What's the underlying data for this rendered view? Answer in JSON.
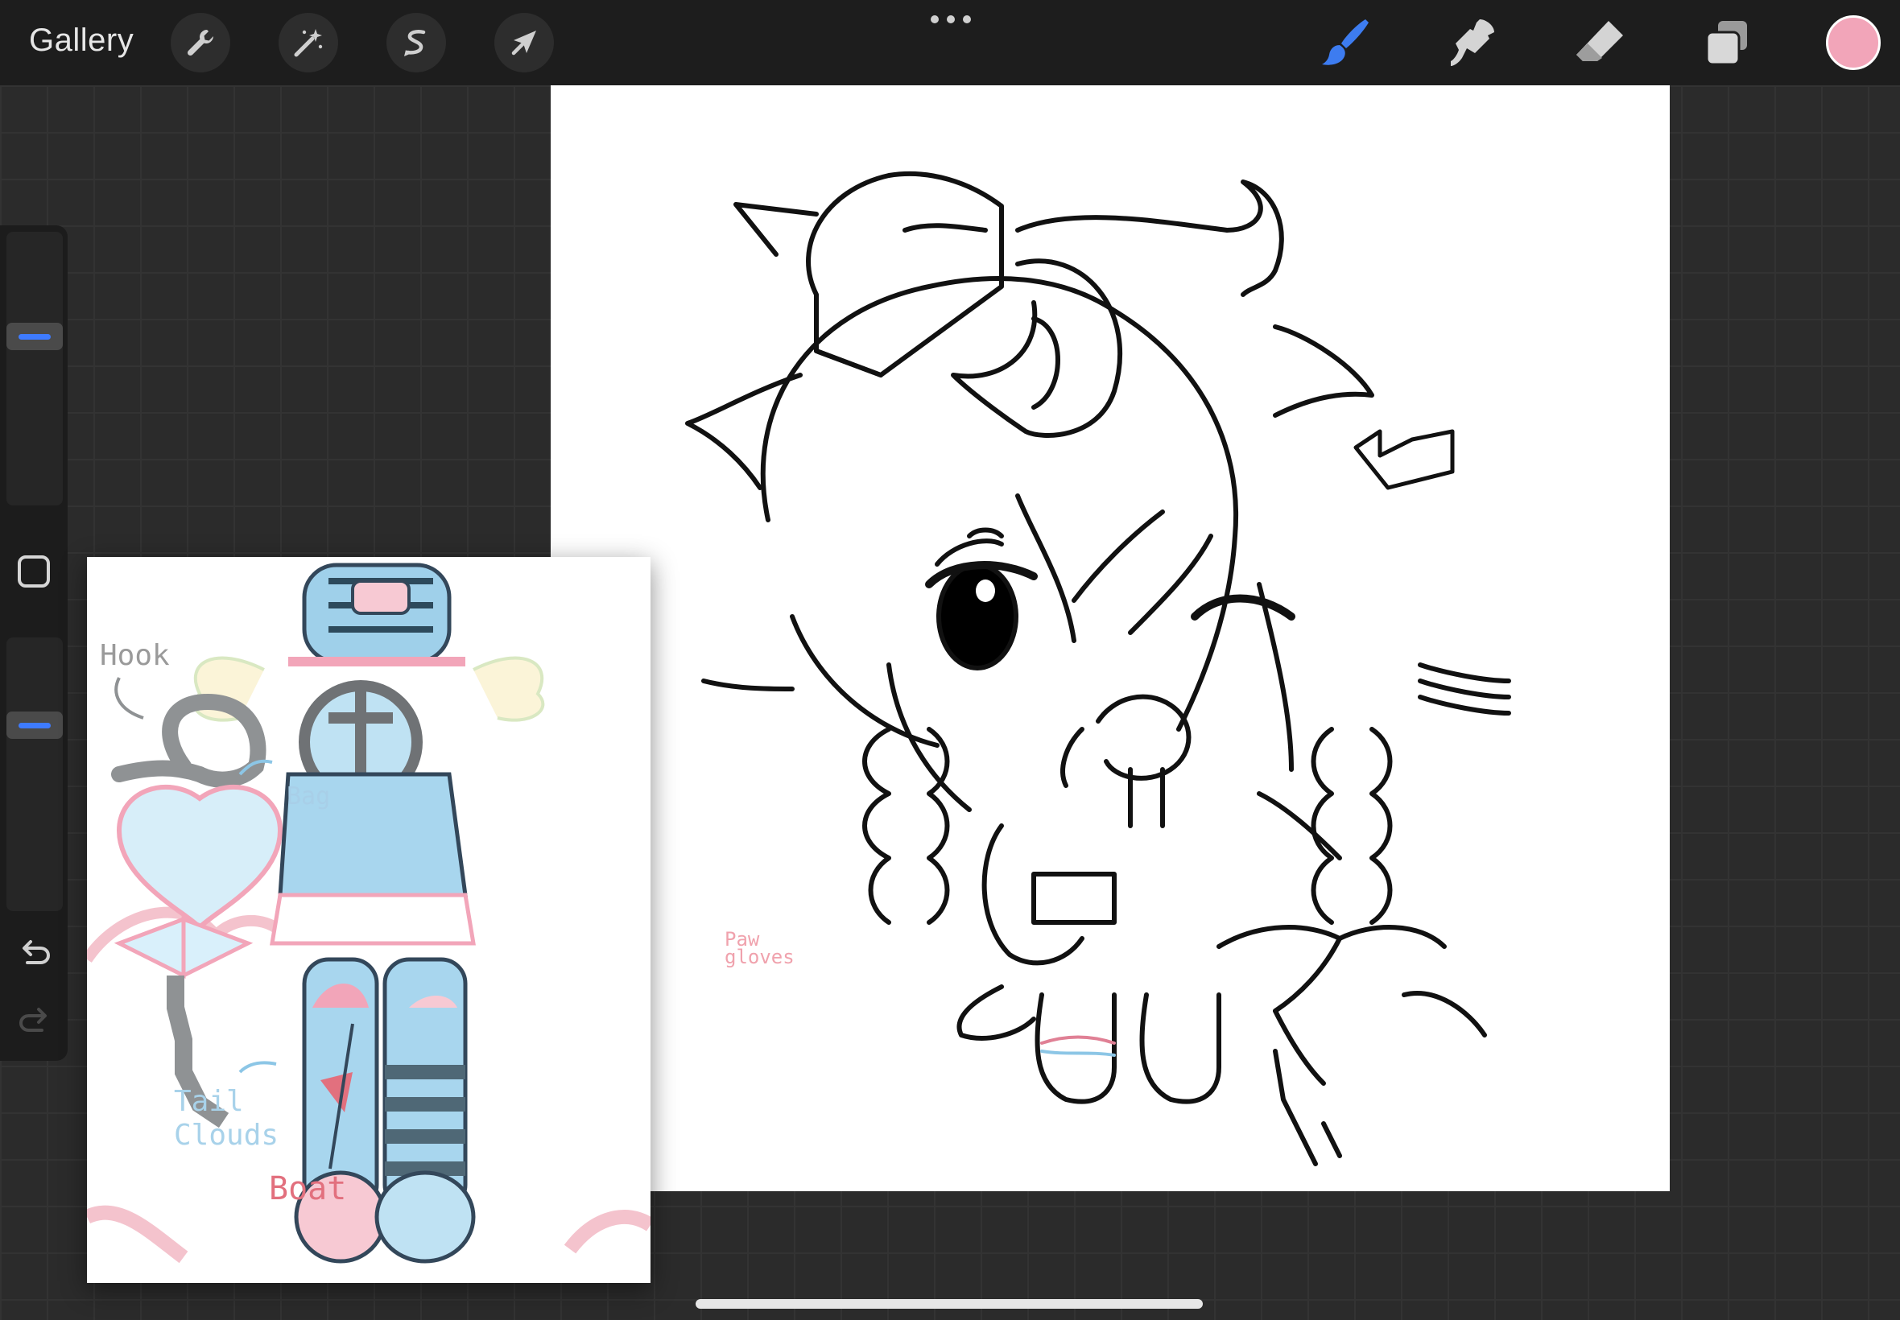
{
  "toolbar": {
    "gallery_label": "Gallery",
    "left_tools": [
      "wrench-icon",
      "magic-wand-icon",
      "selection-icon",
      "transform-arrow-icon"
    ],
    "right_tools": [
      "brush-icon",
      "smudge-icon",
      "eraser-icon",
      "layers-icon"
    ],
    "active_tool": "brush",
    "active_tool_color": "#3d7cf0",
    "current_color": "#f2a5b9"
  },
  "sidebar": {
    "brush_size": 0.37,
    "opacity": 0.3,
    "slider_accent": "#3e7bff"
  },
  "reference": {
    "labels": {
      "hook": "Hook",
      "bag": "Bag",
      "tail_clouds": "Tail\nClouds",
      "boat": "Boat",
      "paw": "Paw\ngloves"
    },
    "colors": {
      "pink": "#f2a5b9",
      "blue": "#a8d6ee",
      "gray": "#9a9a9a"
    }
  }
}
